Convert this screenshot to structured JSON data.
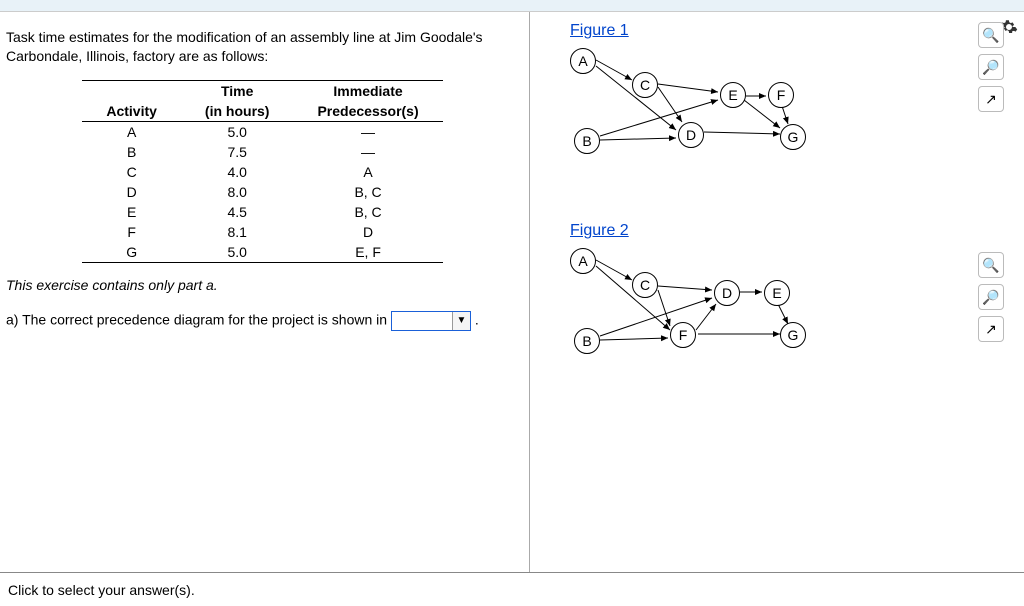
{
  "intro": "Task time estimates for the modification of an assembly line at Jim Goodale's Carbondale, Illinois, factory are as follows:",
  "table": {
    "head1": {
      "c1": "",
      "c2": "Time",
      "c3": "Immediate"
    },
    "head2": {
      "c1": "Activity",
      "c2": "(in hours)",
      "c3": "Predecessor(s)"
    },
    "rows": [
      {
        "a": "A",
        "t": "5.0",
        "p": "—"
      },
      {
        "a": "B",
        "t": "7.5",
        "p": "—"
      },
      {
        "a": "C",
        "t": "4.0",
        "p": "A"
      },
      {
        "a": "D",
        "t": "8.0",
        "p": "B, C"
      },
      {
        "a": "E",
        "t": "4.5",
        "p": "B, C"
      },
      {
        "a": "F",
        "t": "8.1",
        "p": "D"
      },
      {
        "a": "G",
        "t": "5.0",
        "p": "E, F"
      }
    ]
  },
  "note": "This exercise contains only part a.",
  "question_a": "a) The correct precedence diagram for the project is shown in",
  "question_suffix": ".",
  "figures": {
    "f1": {
      "title": "Figure 1",
      "nodes": {
        "A": "A",
        "B": "B",
        "C": "C",
        "D": "D",
        "E": "E",
        "F": "F",
        "G": "G"
      }
    },
    "f2": {
      "title": "Figure 2",
      "nodes": {
        "A": "A",
        "B": "B",
        "C": "C",
        "D": "D",
        "E": "E",
        "F": "F",
        "G": "G"
      }
    }
  },
  "footer": "Click to select your answer(s)."
}
